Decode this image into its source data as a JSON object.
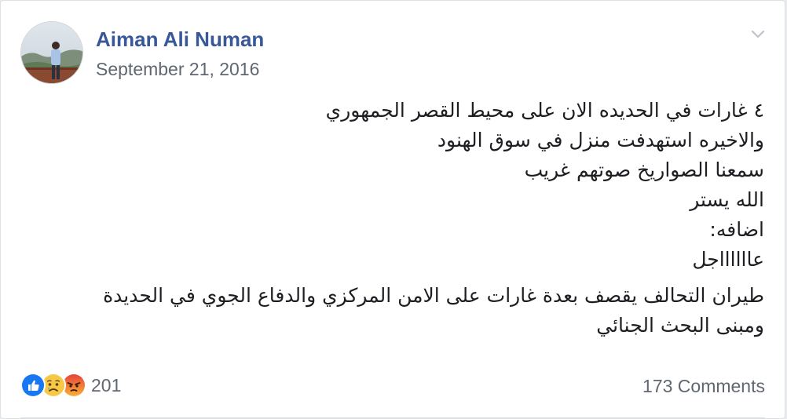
{
  "post": {
    "author": "Aiman Ali Numan",
    "timestamp": "September 21, 2016",
    "body_lines": [
      "٤ غارات في الحديده الان على محيط القصر الجمهوري",
      "والاخيره استهدفت منزل في سوق الهنود",
      "سمعنا الصواريخ صوتهم غريب",
      "الله يستر",
      "اضافه:",
      "عااااااجل"
    ],
    "body_paragraph2": [
      "طيران التحالف يقصف بعدة غارات على الامن المركزي والدفاع الجوي في الحديدة",
      "ومبنى البحث الجنائي"
    ]
  },
  "footer": {
    "reactions": [
      "like-icon",
      "sad-icon",
      "angry-icon"
    ],
    "reaction_count": "201",
    "comments_label": "173 Comments"
  },
  "colors": {
    "author_link": "#385898",
    "meta_text": "#606770",
    "like_blue": "#1877f2",
    "sad_yellow": "#f7c845",
    "angry_red": "#e9710f"
  }
}
